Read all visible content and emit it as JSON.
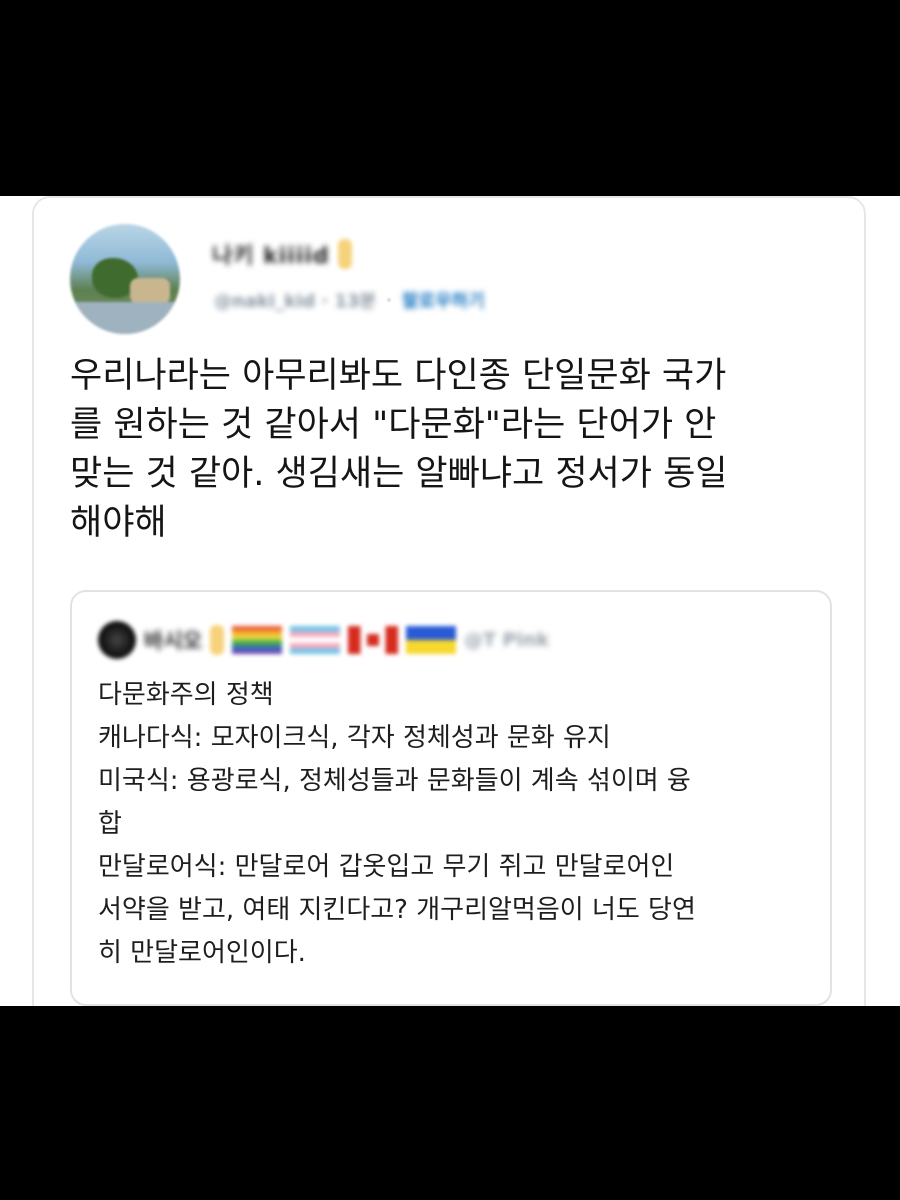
{
  "tweet": {
    "display_name": "나키 kiiiid",
    "handle_and_time": "@naki_kid · 13분",
    "meta_separator": "·",
    "follow_label": "팔로우하기",
    "text_lines": [
      "우리나라는 아무리봐도 다인종 단일문화 국가",
      "를 원하는 것 같아서 \"다문화\"라는 단어가 안",
      "맞는 것 같아. 생김새는 알빠냐고 정서가 동일",
      "해야해"
    ]
  },
  "quoted_tweet": {
    "display_name": "바시오",
    "handle": "@T Pink",
    "body_lines": [
      "다문화주의 정책",
      "캐나다식: 모자이크식, 각자 정체성과 문화 유지",
      "미국식: 용광로식, 정체성들과 문화들이 계속 섞이며 융",
      "합",
      "만달로어식: 만달로어 갑옷입고 무기 쥐고 만달로어인",
      "서약을 받고, 여태 지킨다고? 개구리알먹음이 너도 당연",
      "히 만달로어인이다."
    ]
  },
  "icons": {
    "avatar": "profile-photo",
    "badge": "yellow-badge-icon",
    "flags": [
      "rainbow-flag-icon",
      "trans-flag-icon",
      "canada-flag-icon",
      "ukraine-flag-icon"
    ]
  },
  "colors": {
    "link": "#1b78c2",
    "handle": "#8a96a3",
    "border": "#e4e7ea"
  }
}
